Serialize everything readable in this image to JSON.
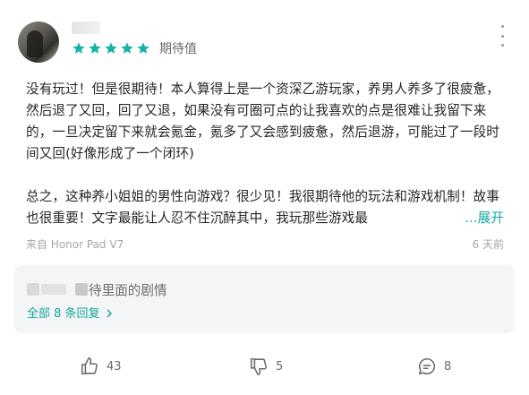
{
  "review": {
    "rating_label": "期待值",
    "stars": 5,
    "star_color": "#14b3aa",
    "paragraph1": "没有玩过！但是很期待！本人算得上是一个资深乙游玩家，养男人养多了很疲惫，然后退了又回，回了又退，如果没有可圈可点的让我喜欢的点是很难让我留下来的，一旦决定留下来就会氪金，氪多了又会感到疲惫，然后退游，可能过了一段时间又回(好像形成了一个闭环)",
    "paragraph2": "总之，这种养小姐姐的男性向游戏？很少见！我很期待他的玩法和游戏机制！故事也很重要！文字最能让人忍不住沉醉其中，我玩那些游戏最",
    "expand_label": "...展开",
    "device": "来自 Honor Pad V7",
    "time": "6 天前"
  },
  "replies": {
    "preview_text": "待里面的剧情",
    "all_label": "全部 8 条回复",
    "accent": "#13a8a0"
  },
  "actions": {
    "like_count": "43",
    "dislike_count": "5",
    "comment_count": "8"
  }
}
